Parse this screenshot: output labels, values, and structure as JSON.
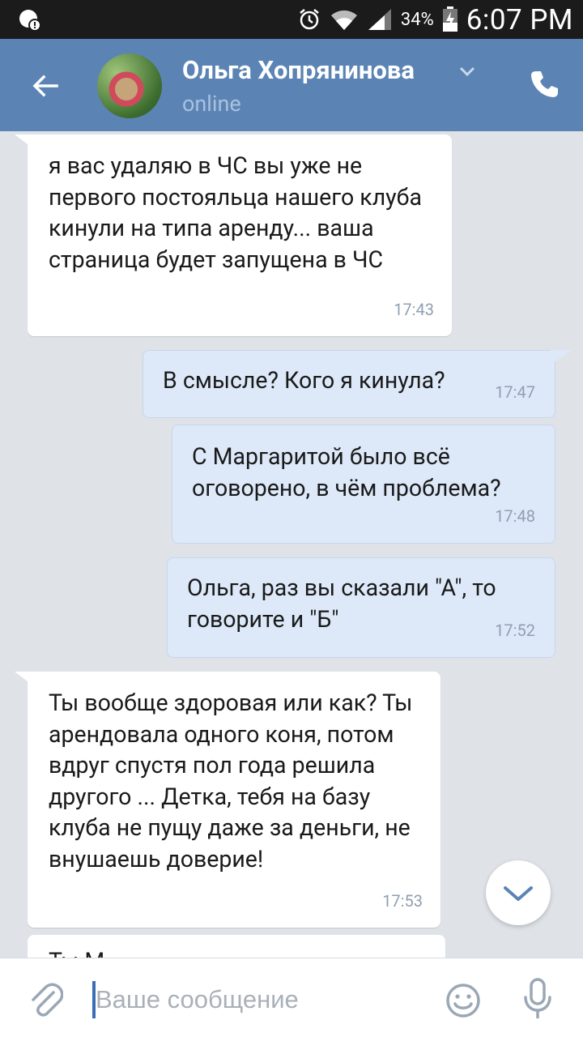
{
  "status_bar": {
    "battery_percent": "34%",
    "time": "6:07 PM"
  },
  "header": {
    "contact_name": "Ольга Хопрянинова",
    "contact_status": "online"
  },
  "messages": [
    {
      "direction": "in",
      "text": "я вас удаляю в ЧС вы уже не первого постояльца нашего клуба кинули на типа аренду... ваша страница будет запущена в ЧС",
      "time": "17:43"
    },
    {
      "direction": "out",
      "text": "В смысле? Кого я кинула?",
      "time": "17:47"
    },
    {
      "direction": "out",
      "text": "С Маргаритой было всё оговорено, в чём проблема?",
      "time": "17:48"
    },
    {
      "direction": "out",
      "text": "Ольга, раз вы сказали \"А\", то говорите и \"Б\"",
      "time": "17:52"
    },
    {
      "direction": "in",
      "text": "Ты вообще здоровая или как? Ты арендовала одного коня, потом вдруг спустя пол года решила другого ... Детка, тебя на базу клуба не пущу даже за деньги, не внушаешь доверие!",
      "time": "17:53"
    },
    {
      "direction": "in",
      "text": "Ты М",
      "time": ""
    }
  ],
  "composer": {
    "placeholder": "Ваше сообщение",
    "value": ""
  },
  "icons": {
    "back": "arrow-left-icon",
    "call": "phone-icon",
    "attach": "paperclip-icon",
    "emoji": "smiley-icon",
    "mic": "microphone-icon",
    "scroll_down": "chevron-down-icon"
  },
  "colors": {
    "header_bg": "#5b84b5",
    "outgoing_bubble": "#dde9f9",
    "incoming_bubble": "#ffffff",
    "chat_bg": "#dfe3e8"
  }
}
